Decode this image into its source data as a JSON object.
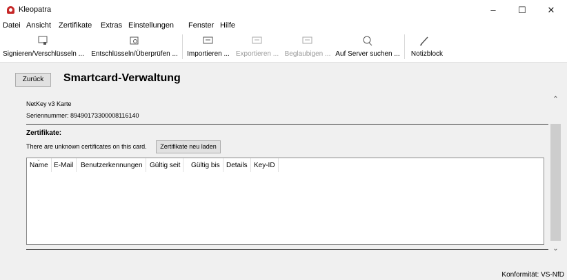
{
  "window": {
    "title": "Kleopatra",
    "minimize": "–",
    "maximize": "☐",
    "close": "✕"
  },
  "menu": [
    "Datei",
    "Ansicht",
    "Zertifikate",
    "Extras",
    "Einstellungen",
    "Fenster",
    "Hilfe"
  ],
  "toolbar": {
    "sign_encrypt": "Signieren/Verschlüsseln ...",
    "decrypt_verify": "Entschlüsseln/Überprüfen ...",
    "import": "Importieren ...",
    "export": "Exportieren ...",
    "certify": "Beglaubigen ...",
    "lookup": "Auf Server suchen ...",
    "notepad": "Notizblock"
  },
  "page": {
    "back_label": "Zurück",
    "title": "Smartcard-Verwaltung"
  },
  "card": {
    "name": "NetKey v3 Karte",
    "serial": "Seriennummer: 89490173300008116140"
  },
  "certificates": {
    "heading": "Zertifikate:",
    "unknown_notice": "There are unknown certificates on this card.",
    "reload_label": "Zertifikate neu laden",
    "columns": [
      "Name",
      "E-Mail",
      "Benutzerkennungen",
      "Gültig seit",
      "Gültig bis",
      "Details",
      "Key-ID"
    ]
  },
  "status": {
    "compliance": "Konformität: VS-NfD"
  },
  "scroll": {
    "up": "⌃",
    "down": "⌄"
  },
  "icons": [
    "sign-encrypt-icon",
    "decrypt-verify-icon",
    "import-icon",
    "export-icon",
    "certify-icon",
    "search-icon",
    "notepad-icon"
  ]
}
